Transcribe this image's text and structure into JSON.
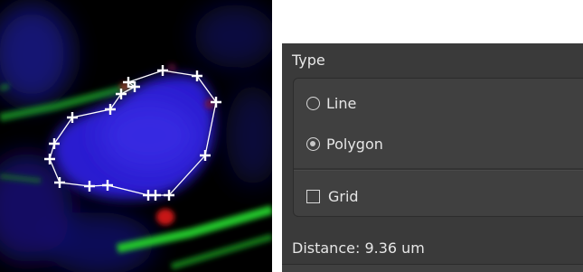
{
  "panel": {
    "type_title": "Type",
    "options": {
      "line": {
        "label": "Line",
        "checked": false
      },
      "polygon": {
        "label": "Polygon",
        "checked": true
      },
      "grid": {
        "label": "Grid",
        "checked": false
      }
    },
    "distance": "Distance: 9.36 um"
  },
  "viewport": {
    "tool": "polygon",
    "vertex_count": 21,
    "colors": {
      "background": "#000000",
      "nucleus": "#2a1fd0",
      "filament": "#1fbf2a",
      "spot": "#d01818",
      "polygon": "#ffffff"
    }
  },
  "theme": {
    "panel_bg": "#3a3a3a",
    "group_bg": "#404040",
    "text": "#e6e6e6"
  }
}
